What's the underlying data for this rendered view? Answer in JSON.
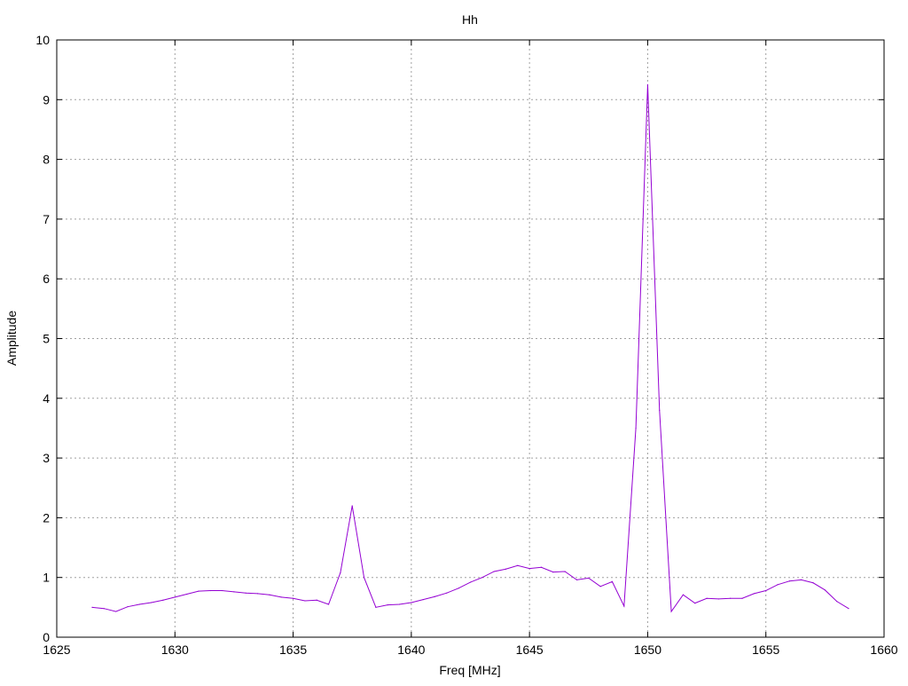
{
  "chart_data": {
    "type": "line",
    "title": "Hh",
    "xlabel": "Freq [MHz]",
    "ylabel": "Amplitude",
    "xlim": [
      1625,
      1660
    ],
    "ylim": [
      0,
      10
    ],
    "xticks": [
      1625,
      1630,
      1635,
      1640,
      1645,
      1650,
      1655,
      1660
    ],
    "yticks": [
      0,
      1,
      2,
      3,
      4,
      5,
      6,
      7,
      8,
      9,
      10
    ],
    "grid": true,
    "grid_style": "dotted",
    "series": [
      {
        "color": "#9400d3",
        "points": [
          [
            1626.5,
            0.5
          ],
          [
            1627.0,
            0.48
          ],
          [
            1627.5,
            0.43
          ],
          [
            1628.0,
            0.51
          ],
          [
            1628.5,
            0.55
          ],
          [
            1629.0,
            0.58
          ],
          [
            1629.5,
            0.62
          ],
          [
            1630.0,
            0.67
          ],
          [
            1630.5,
            0.72
          ],
          [
            1631.0,
            0.77
          ],
          [
            1631.5,
            0.78
          ],
          [
            1632.0,
            0.78
          ],
          [
            1632.5,
            0.76
          ],
          [
            1633.0,
            0.74
          ],
          [
            1633.5,
            0.73
          ],
          [
            1634.0,
            0.71
          ],
          [
            1634.5,
            0.67
          ],
          [
            1635.0,
            0.65
          ],
          [
            1635.5,
            0.61
          ],
          [
            1636.0,
            0.62
          ],
          [
            1636.5,
            0.55
          ],
          [
            1637.0,
            1.08
          ],
          [
            1637.5,
            2.2
          ],
          [
            1638.0,
            1.0
          ],
          [
            1638.5,
            0.5
          ],
          [
            1639.0,
            0.54
          ],
          [
            1639.5,
            0.55
          ],
          [
            1640.0,
            0.58
          ],
          [
            1640.5,
            0.63
          ],
          [
            1641.0,
            0.68
          ],
          [
            1641.5,
            0.74
          ],
          [
            1642.0,
            0.82
          ],
          [
            1642.5,
            0.92
          ],
          [
            1643.0,
            1.0
          ],
          [
            1643.5,
            1.1
          ],
          [
            1644.0,
            1.14
          ],
          [
            1644.5,
            1.2
          ],
          [
            1645.0,
            1.15
          ],
          [
            1645.5,
            1.17
          ],
          [
            1646.0,
            1.09
          ],
          [
            1646.5,
            1.1
          ],
          [
            1647.0,
            0.96
          ],
          [
            1647.5,
            0.99
          ],
          [
            1648.0,
            0.85
          ],
          [
            1648.5,
            0.93
          ],
          [
            1649.0,
            0.52
          ],
          [
            1649.5,
            3.5
          ],
          [
            1650.0,
            9.25
          ],
          [
            1650.5,
            3.8
          ],
          [
            1651.0,
            0.43
          ],
          [
            1651.5,
            0.71
          ],
          [
            1652.0,
            0.57
          ],
          [
            1652.5,
            0.65
          ],
          [
            1653.0,
            0.64
          ],
          [
            1653.5,
            0.65
          ],
          [
            1654.0,
            0.65
          ],
          [
            1654.5,
            0.73
          ],
          [
            1655.0,
            0.78
          ],
          [
            1655.5,
            0.88
          ],
          [
            1656.0,
            0.94
          ],
          [
            1656.5,
            0.96
          ],
          [
            1657.0,
            0.91
          ],
          [
            1657.5,
            0.79
          ],
          [
            1658.0,
            0.6
          ],
          [
            1658.5,
            0.48
          ]
        ]
      }
    ]
  }
}
